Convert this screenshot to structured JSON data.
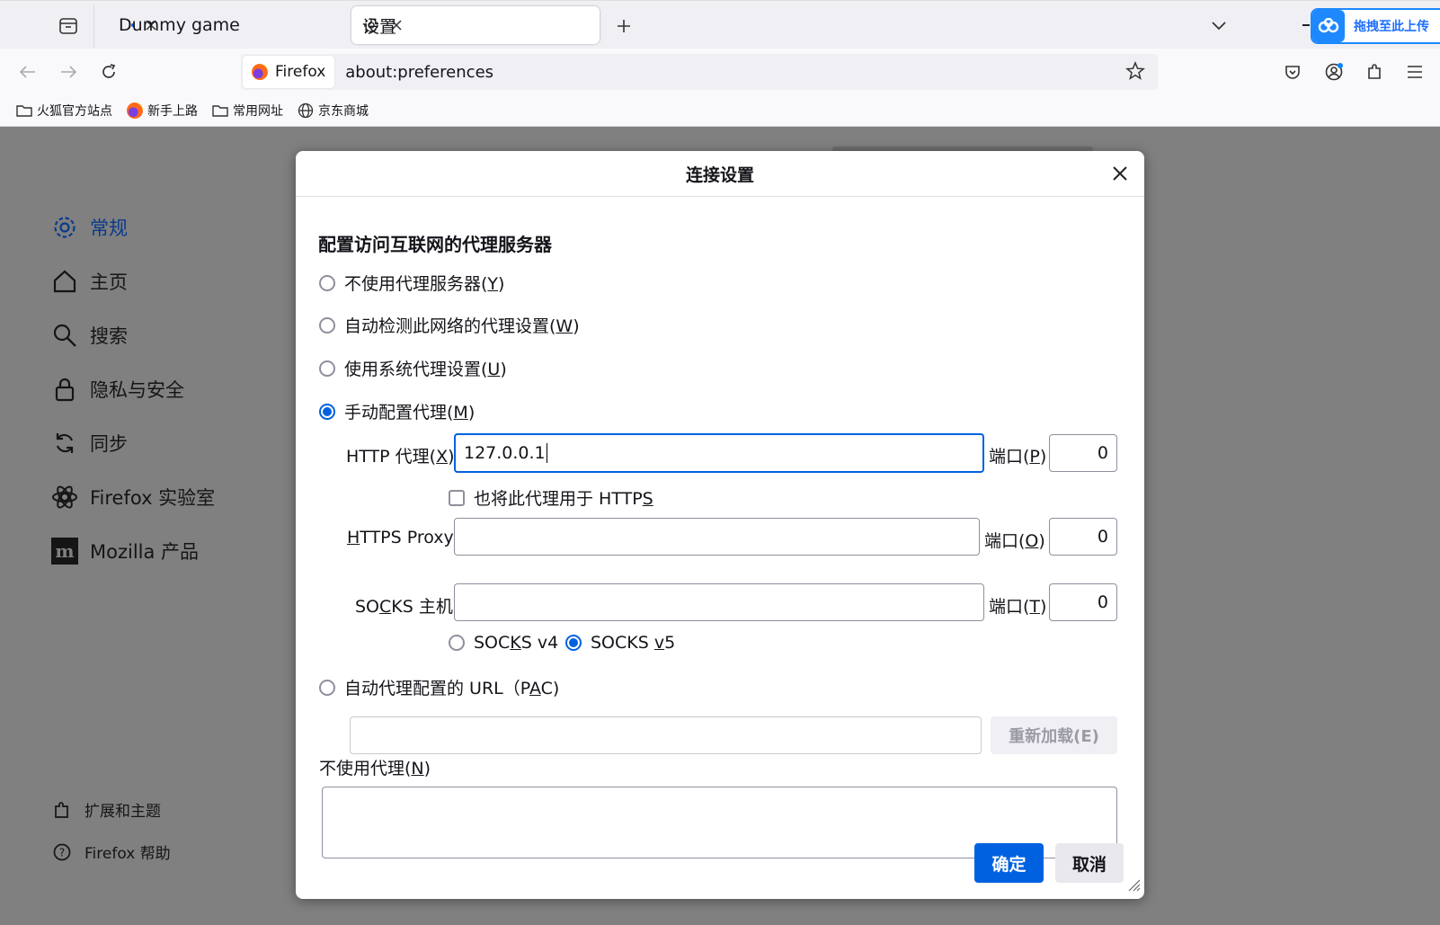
{
  "tabs": [
    {
      "label": "Dummy game",
      "active": false
    },
    {
      "label": "设置",
      "active": true
    }
  ],
  "baidu_upload": {
    "label": "拖拽至此上传"
  },
  "urlbar": {
    "identity": "Firefox",
    "url": "about:preferences"
  },
  "bookmarks": [
    {
      "label": "火狐官方站点",
      "icon": "folder-icon"
    },
    {
      "label": "新手上路",
      "icon": "firefox-icon"
    },
    {
      "label": "常用网址",
      "icon": "folder-icon"
    },
    {
      "label": "京东商城",
      "icon": "globe-icon"
    }
  ],
  "sidebar": {
    "items": [
      {
        "label": "常规",
        "icon": "gear-icon",
        "active": true
      },
      {
        "label": "主页",
        "icon": "home-icon"
      },
      {
        "label": "搜索",
        "icon": "search-icon"
      },
      {
        "label": "隐私与安全",
        "icon": "lock-icon"
      },
      {
        "label": "同步",
        "icon": "sync-icon"
      },
      {
        "label": "Firefox 实验室",
        "icon": "labs-icon"
      },
      {
        "label": "Mozilla 产品",
        "icon": "mozilla-icon"
      }
    ],
    "footer": [
      {
        "label": "扩展和主题",
        "icon": "puzzle-icon"
      },
      {
        "label": "Firefox 帮助",
        "icon": "help-icon"
      }
    ]
  },
  "dialog": {
    "title": "连接设置",
    "section_title": "配置访问互联网的代理服务器",
    "options": {
      "no_proxy": {
        "text": "不使用代理服务器(",
        "key": "Y",
        "end": ")"
      },
      "auto_detect": {
        "text": "自动检测此网络的代理设置(",
        "key": "W",
        "end": ")"
      },
      "system": {
        "text": "使用系统代理设置(",
        "key": "U",
        "end": ")"
      },
      "manual": {
        "text": "手动配置代理(",
        "key": "M",
        "end": ")"
      },
      "pac": {
        "text": "自动代理配置的 URL（P",
        "key": "A",
        "end": "C)"
      }
    },
    "selected_option": "manual",
    "http": {
      "label_pre": "HTTP 代理(",
      "key": "X",
      "label_post": ")",
      "value": "127.0.0.1",
      "port_pre": "端口(",
      "port_key": "P",
      "port_post": ")",
      "port": "0"
    },
    "https_checkbox": {
      "text": "也将此代理用于 HTTP",
      "key": "S",
      "checked": false
    },
    "https": {
      "label_key": "H",
      "label_rest": "TTPS Proxy",
      "value": "",
      "port_pre": "端口(",
      "port_key": "O",
      "port_post": ")",
      "port": "0"
    },
    "socks": {
      "label_a": "SO",
      "key": "C",
      "label_b": "KS 主机",
      "value": "",
      "port_pre": "端口(",
      "port_key": "T",
      "port_post": ")",
      "port": "0"
    },
    "socks_v4": {
      "a": "SOC",
      "key": "K",
      "b": "S v4",
      "selected": false
    },
    "socks_v5": {
      "a": "SOCKS ",
      "key": "v",
      "b": "5",
      "selected": true
    },
    "pac_url": "",
    "reload_button": "重新加载(E)",
    "no_proxy_for": {
      "text": "不使用代理(",
      "key": "N",
      "end": ")",
      "value": ""
    },
    "ok_button": "确定",
    "cancel_button": "取消"
  },
  "colors": {
    "accent": "#0061e0",
    "overlay": "#808080"
  }
}
